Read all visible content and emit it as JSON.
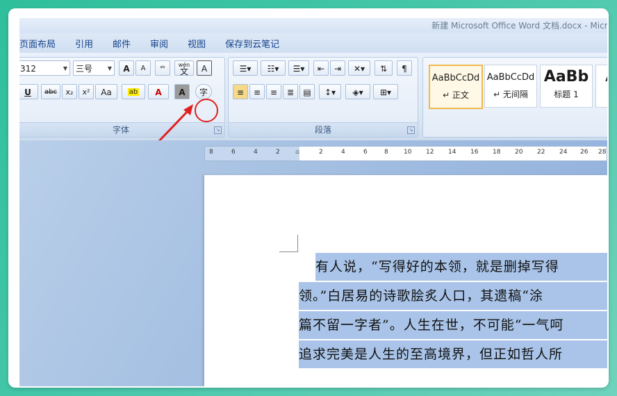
{
  "title_bar": {
    "text": "新建 Microsoft Office Word 文档.docx - Microsoft"
  },
  "menu_tabs": [
    "页面布局",
    "引用",
    "邮件",
    "审阅",
    "视图",
    "保存到云笔记"
  ],
  "font_group": {
    "font_name": "312",
    "font_size": "三号",
    "grow_label": "A",
    "shrink_label": "A",
    "clear_label": "ᵃᵇ",
    "phonetic_label": "wén",
    "phonetic_char": "文",
    "border_label": "A",
    "underline_label": "U",
    "strike_label": "abc",
    "subscript_label": "x₂",
    "superscript_label": "x²",
    "case_label": "Aa",
    "highlight_label": "ab",
    "color_label": "A",
    "shade_label": "A",
    "enclose_label": "字",
    "group_label": "字体"
  },
  "paragraph_group": {
    "group_label": "段落"
  },
  "styles": [
    {
      "sample": "AaBbCcDd",
      "name": "↵ 正文"
    },
    {
      "sample": "AaBbCcDd",
      "name": "↵ 无间隔"
    },
    {
      "sample": "AaBb",
      "name": "标题 1"
    },
    {
      "sample": "A",
      "name": ""
    }
  ],
  "ruler_numbers": [
    "8",
    "6",
    "4",
    "2",
    "",
    "2",
    "4",
    "6",
    "8",
    "10",
    "12",
    "14",
    "16",
    "18",
    "20",
    "22",
    "24",
    "26",
    "28"
  ],
  "document": {
    "lines": [
      "有人说，“写得好的本领，就是删掉写得",
      "领。”白居易的诗歌脍炙人口，其遗稿“涂",
      "篇不留一字者”。人生在世，不可能“一气呵",
      "追求完美是人生的至高境界，但正如哲人所"
    ]
  },
  "colors": {
    "annotation": "#e0201c",
    "selection": "#a9c4e8",
    "ribbon": "#dce8f6"
  }
}
